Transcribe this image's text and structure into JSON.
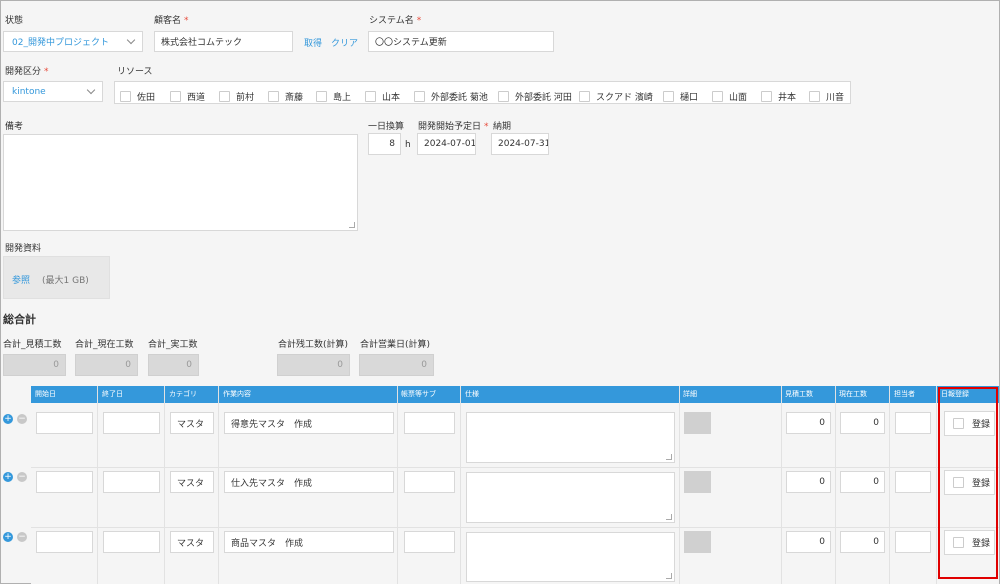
{
  "status": {
    "label": "状態",
    "value": "02_開発中プロジェクト"
  },
  "customer": {
    "label": "顧客名",
    "value": "株式会社コムテック",
    "fetch_label": "取得",
    "clear_label": "クリア"
  },
  "system": {
    "label": "システム名",
    "value": "〇〇システム更新"
  },
  "dev_category": {
    "label": "開発区分",
    "value": "kintone"
  },
  "resources": {
    "label": "リソース",
    "items": [
      "佐田",
      "西道",
      "前村",
      "斎藤",
      "島上",
      "山本",
      "外部委託 菊池",
      "外部委託 河田",
      "スクアド 濱崎",
      "樋口",
      "山面",
      "井本",
      "川音"
    ]
  },
  "notes": {
    "label": "備考"
  },
  "daily_hours": {
    "label": "一日換算",
    "value": "8",
    "unit": "h"
  },
  "start_date": {
    "label": "開発開始予定日",
    "value": "2024-07-01"
  },
  "due_date": {
    "label": "納期",
    "value": "2024-07-31"
  },
  "attachments": {
    "label": "開発資料",
    "browse_label": "参照",
    "max_label": "(最大1 GB)"
  },
  "summary": {
    "title": "総合計",
    "fields": [
      {
        "label": "合計_見積工数",
        "value": "0"
      },
      {
        "label": "合計_現在工数",
        "value": "0"
      },
      {
        "label": "合計_実工数",
        "value": "0"
      },
      {
        "label": "合計残工数(計算)",
        "value": "0"
      },
      {
        "label": "合計営業日(計算)",
        "value": "0"
      }
    ]
  },
  "table": {
    "headers": [
      "開始日",
      "終了日",
      "カテゴリ",
      "作業内容",
      "帳票等サブ",
      "仕様",
      "詳細",
      "見積工数",
      "現在工数",
      "担当者",
      "日報登録"
    ],
    "register_label": "登録",
    "rows": [
      {
        "category": "マスタ",
        "task": "得意先マスタ　作成",
        "est": "0",
        "cur": "0"
      },
      {
        "category": "マスタ",
        "task": "仕入先マスタ　作成",
        "est": "0",
        "cur": "0"
      },
      {
        "category": "マスタ",
        "task": "商品マスタ　作成",
        "est": "0",
        "cur": "0"
      }
    ]
  },
  "colors": {
    "accent": "#3498db",
    "required": "#e74c3c",
    "highlight": "#e00000"
  }
}
